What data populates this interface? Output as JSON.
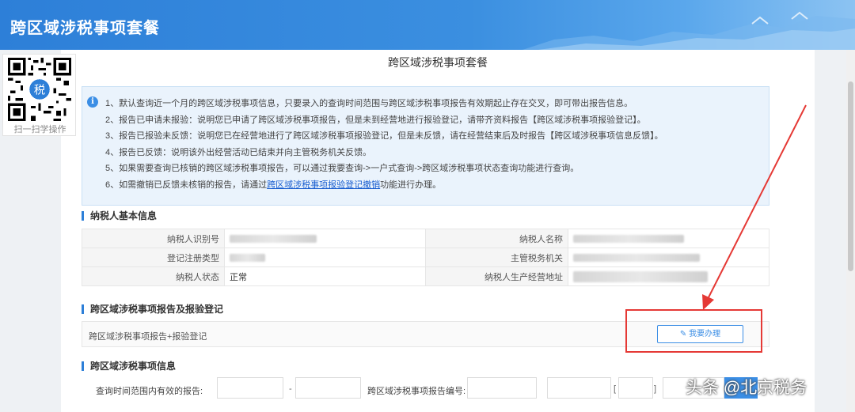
{
  "header": {
    "title": "跨区域涉税事项套餐"
  },
  "qr": {
    "caption": "扫一扫学操作",
    "center_text": "税"
  },
  "page": {
    "title": "跨区域涉税事项套餐"
  },
  "notice": {
    "items": [
      "1、默认查询近一个月的跨区域涉税事项信息，只要录入的查询时间范围与跨区域涉税事项报告有效期起止存在交叉，即可带出报告信息。",
      "2、报告已申请未报验：说明您已申请了跨区域涉税事项报告，但是未到经营地进行报验登记，请带齐资料报告【跨区域涉税事项报验登记】。",
      "3、报告已报验未反馈：说明您已在经营地进行了跨区域涉税事项报验登记，但是未反馈，请在经营结束后及时报告【跨区域涉税事项信息反馈】。",
      "4、报告已反馈：说明该外出经营活动已结束并向主管税务机关反馈。",
      "5、如果需要查询已核销的跨区域涉税事项报告，可以通过我要查询->一户式查询->跨区域涉税事项状态查询功能进行查询。"
    ],
    "last_prefix": "6、如需撤销已反馈未核销的报告，请通过",
    "last_link": "跨区域涉税事项报验登记撤销",
    "last_suffix": "功能进行办理。"
  },
  "taxpayer_section": {
    "title": "纳税人基本信息",
    "rows": [
      {
        "label1": "纳税人识别号",
        "value1": "",
        "label2": "纳税人名称",
        "value2": ""
      },
      {
        "label1": "登记注册类型",
        "value1": "",
        "label2": "主管税务机关",
        "value2": ""
      },
      {
        "label1": "纳税人状态",
        "value1": "正常",
        "label2": "纳税人生产经营地址",
        "value2": ""
      }
    ]
  },
  "report_section": {
    "title": "跨区域涉税事项报告及报验登记",
    "row_text": "跨区域涉税事项报告+报验登记",
    "button_label": "我要办理",
    "button_icon": "edit-icon"
  },
  "info_section": {
    "title": "跨区域涉税事项信息",
    "query_label": "查询时间范围内有效的报告:",
    "range_separator": "-",
    "report_no_label": "跨区域涉税事项报告编号:",
    "bracket_open": "[",
    "bracket_close": "]"
  },
  "watermark": "头条 @北京税务",
  "colors": {
    "header": "#2d7fd8",
    "accent": "#3b8ee5",
    "highlight": "#e53935"
  }
}
